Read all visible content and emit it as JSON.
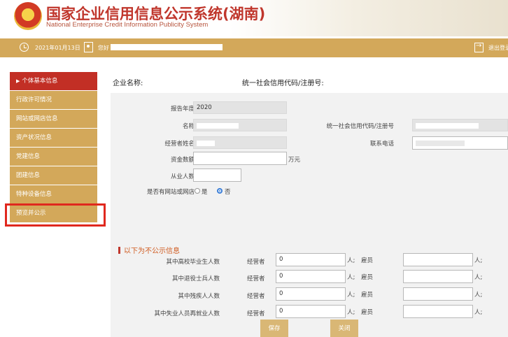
{
  "header": {
    "title": "国家企业信用信息公示系统(湖南)",
    "subtitle": "National Enterprise Credit Information Publicity System"
  },
  "topbar": {
    "date": "2021年01月13日",
    "greeting": "您好",
    "logout": "退出登录"
  },
  "sidebar": {
    "items": [
      {
        "label": "个体基本信息",
        "active": true
      },
      {
        "label": "行政许可情况",
        "active": false
      },
      {
        "label": "网站或网店信息",
        "active": false
      },
      {
        "label": "资产状况信息",
        "active": false
      },
      {
        "label": "党建信息",
        "active": false
      },
      {
        "label": "团建信息",
        "active": false
      },
      {
        "label": "特种设备信息",
        "active": false
      },
      {
        "label": "预览并公示",
        "active": false
      }
    ]
  },
  "company": {
    "name_label": "企业名称:",
    "code_label": "统一社会信用代码/注册号:"
  },
  "form": {
    "report_year_label": "报告年度",
    "report_year_value": "2020",
    "name_label": "名称",
    "credit_code_label": "统一社会信用代码/注册号",
    "operator_label": "经营者姓名",
    "phone_label": "联系电话",
    "capital_label": "资金数额",
    "capital_unit": "万元",
    "employees_label": "从业人数",
    "website_label": "是否有网站或网店",
    "option_yes": "是",
    "option_no": "否"
  },
  "non_public": {
    "title": "以下为不公示信息",
    "operator_label": "经营者",
    "employee_label": "雇员",
    "person_unit": "人;",
    "rows": [
      {
        "label": "其中高校毕业生人数",
        "operator_value": "0"
      },
      {
        "label": "其中退役士兵人数",
        "operator_value": "0"
      },
      {
        "label": "其中残疾人人数",
        "operator_value": "0"
      },
      {
        "label": "其中失业人员再就业人数",
        "operator_value": "0"
      }
    ]
  },
  "buttons": {
    "save": "保存",
    "close": "关闭"
  },
  "colors": {
    "gold": "#d3a85a",
    "active_red": "#c22f25",
    "title_red": "#c0362c",
    "button_gold": "#d9b775"
  }
}
